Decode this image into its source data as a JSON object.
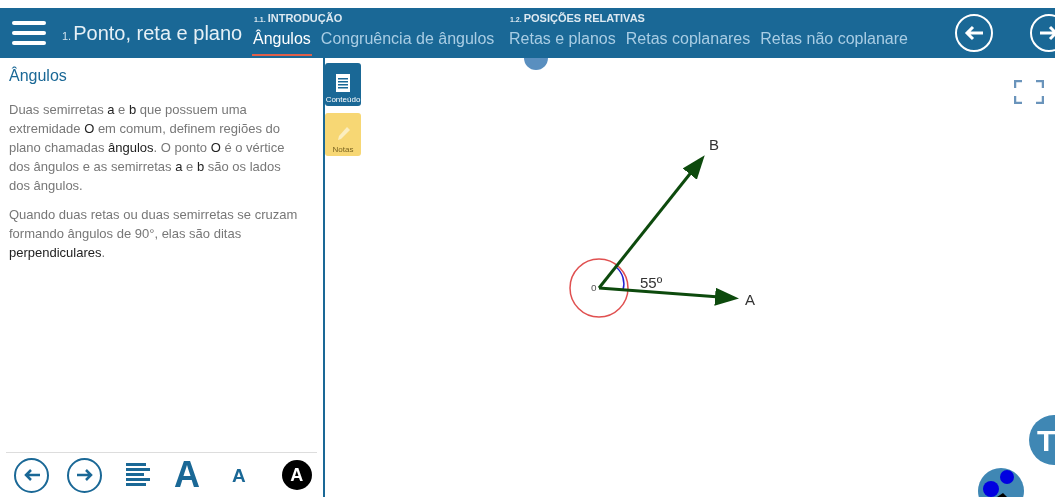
{
  "header": {
    "chapter_number": "1.",
    "chapter_title": "Ponto, reta e plano",
    "sections": [
      {
        "number": "1.1.",
        "title": "INTRODUÇÃO",
        "tabs": [
          {
            "label": "Ângulos",
            "selected": true
          },
          {
            "label": "Congruência de ângulos",
            "selected": false
          }
        ]
      },
      {
        "number": "1.2.",
        "title": "POSIÇÕES RELATIVAS",
        "tabs": [
          {
            "label": "Retas e planos",
            "selected": false
          },
          {
            "label": "Retas coplanares",
            "selected": false
          },
          {
            "label": "Retas não coplanare",
            "selected": false
          }
        ]
      }
    ]
  },
  "side_tabs": [
    {
      "label": "Conteúdo",
      "selected": true
    },
    {
      "label": "Notas",
      "selected": false
    }
  ],
  "content": {
    "title": "Ângulos",
    "paragraphs": [
      "Duas semirretas **a** e **b** que possuem uma extremidade **O** em comum, definem regiões do plano chamadas **ângulos**. O ponto **O** é o vértice dos ângulos e as semirretas **a** e **b** são os lados dos ângulos.",
      "Quando duas retas ou duas semirretas se cruzam formando ângulos de 90°, elas são ditas **perpendiculares**."
    ]
  },
  "figure": {
    "vertex_label": "o",
    "ray_b_label": "B",
    "ray_a_label": "A",
    "angle_label": "55º"
  },
  "toolbar": {
    "large_font": "A",
    "small_font": "A",
    "contrast": "A"
  },
  "corner_button": "T"
}
